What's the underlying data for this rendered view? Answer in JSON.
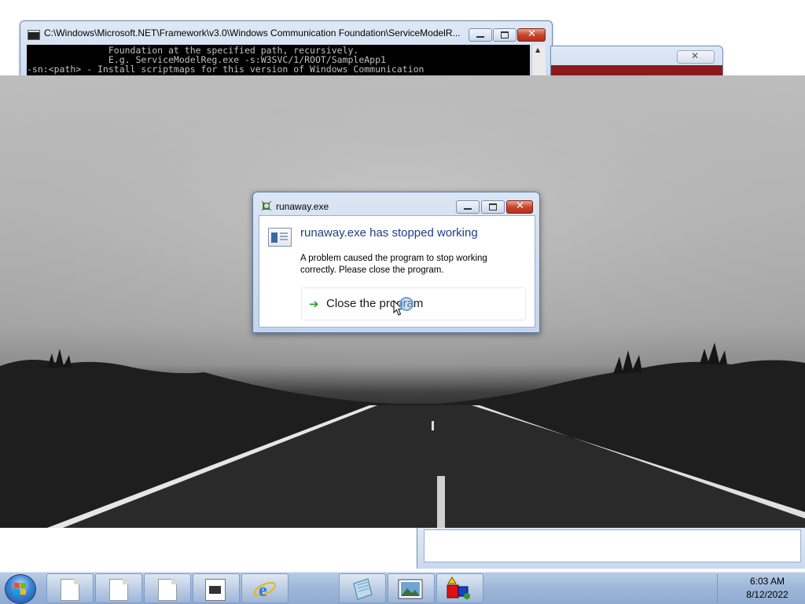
{
  "console_window": {
    "title": "C:\\Windows\\Microsoft.NET\\Framework\\v3.0\\Windows Communication Foundation\\ServiceModelR...",
    "lines": [
      "               Foundation at the specified path, recursively.",
      "               E.g. ServiceModelReg.exe -s:W3SVC/1/ROOT/SampleApp1",
      "-sn:<path> - Install scriptmaps for this version of Windows Communication"
    ]
  },
  "dialog": {
    "title": "runaway.exe",
    "heading": "runaway.exe has stopped working",
    "message": "A problem caused the program to stop working correctly. Please close the program.",
    "action_label": "Close the program"
  },
  "taskbar": {
    "clock_time": "6:03 AM",
    "clock_date": "8/12/2022",
    "items": [
      {
        "icon": "document-icon"
      },
      {
        "icon": "document-icon"
      },
      {
        "icon": "document-icon"
      },
      {
        "icon": "console-app-icon"
      },
      {
        "icon": "internet-explorer-icon"
      },
      {
        "icon": "notepad-icon"
      },
      {
        "icon": "image-viewer-icon"
      },
      {
        "icon": "shapes-app-icon"
      }
    ]
  }
}
